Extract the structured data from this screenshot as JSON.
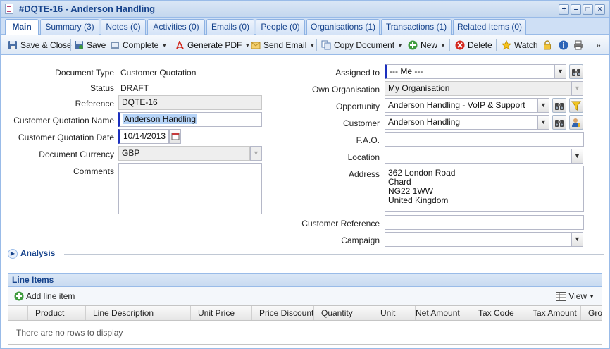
{
  "window": {
    "title": "#DQTE-16 - Anderson Handling",
    "controls": [
      "pin",
      "minimize",
      "maximize",
      "close"
    ]
  },
  "tabs": [
    {
      "label": "Main",
      "active": true
    },
    {
      "label": "Summary (3)"
    },
    {
      "label": "Notes (0)"
    },
    {
      "label": "Activities (0)"
    },
    {
      "label": "Emails (0)"
    },
    {
      "label": "People (0)"
    },
    {
      "label": "Organisations (1)"
    },
    {
      "label": "Transactions (1)"
    },
    {
      "label": "Related Items (0)"
    }
  ],
  "toolbar": {
    "save_close": "Save & Close",
    "save": "Save",
    "complete": "Complete",
    "generate_pdf": "Generate PDF",
    "send_email": "Send Email",
    "copy_document": "Copy Document",
    "new": "New",
    "delete": "Delete",
    "watch": "Watch"
  },
  "form": {
    "document_type": {
      "label": "Document Type",
      "value": "Customer Quotation"
    },
    "status": {
      "label": "Status",
      "value": "DRAFT"
    },
    "reference": {
      "label": "Reference",
      "value": "DQTE-16"
    },
    "quotation_name": {
      "label": "Customer Quotation Name",
      "value": "Anderson Handling"
    },
    "quotation_date": {
      "label": "Customer Quotation Date",
      "value": "10/14/2013"
    },
    "currency": {
      "label": "Document Currency",
      "value": "GBP"
    },
    "comments": {
      "label": "Comments",
      "value": ""
    },
    "assigned_to": {
      "label": "Assigned to",
      "value": "--- Me ---"
    },
    "own_organisation": {
      "label": "Own Organisation",
      "value": "My Organisation"
    },
    "opportunity": {
      "label": "Opportunity",
      "value": "Anderson Handling - VoIP & Support"
    },
    "customer": {
      "label": "Customer",
      "value": "Anderson Handling"
    },
    "fao": {
      "label": "F.A.O.",
      "value": ""
    },
    "location": {
      "label": "Location",
      "value": ""
    },
    "address": {
      "label": "Address",
      "value": "362 London Road\nChard\nNG22 1WW\nUnited Kingdom"
    },
    "customer_reference": {
      "label": "Customer Reference",
      "value": ""
    },
    "campaign": {
      "label": "Campaign",
      "value": ""
    }
  },
  "analysis": {
    "label": "Analysis"
  },
  "line_items": {
    "title": "Line Items",
    "add_label": "Add line item",
    "view_label": "View",
    "columns": [
      "Product",
      "Line Description",
      "Unit Price",
      "Price Discount",
      "Quantity",
      "Unit",
      "Net Amount",
      "Tax Code",
      "Tax Amount",
      "Gro"
    ],
    "empty_text": "There are no rows to display"
  },
  "colors": {
    "accent": "#15428b",
    "border": "#99bbe8",
    "required_marker": "#1b2fbf"
  }
}
